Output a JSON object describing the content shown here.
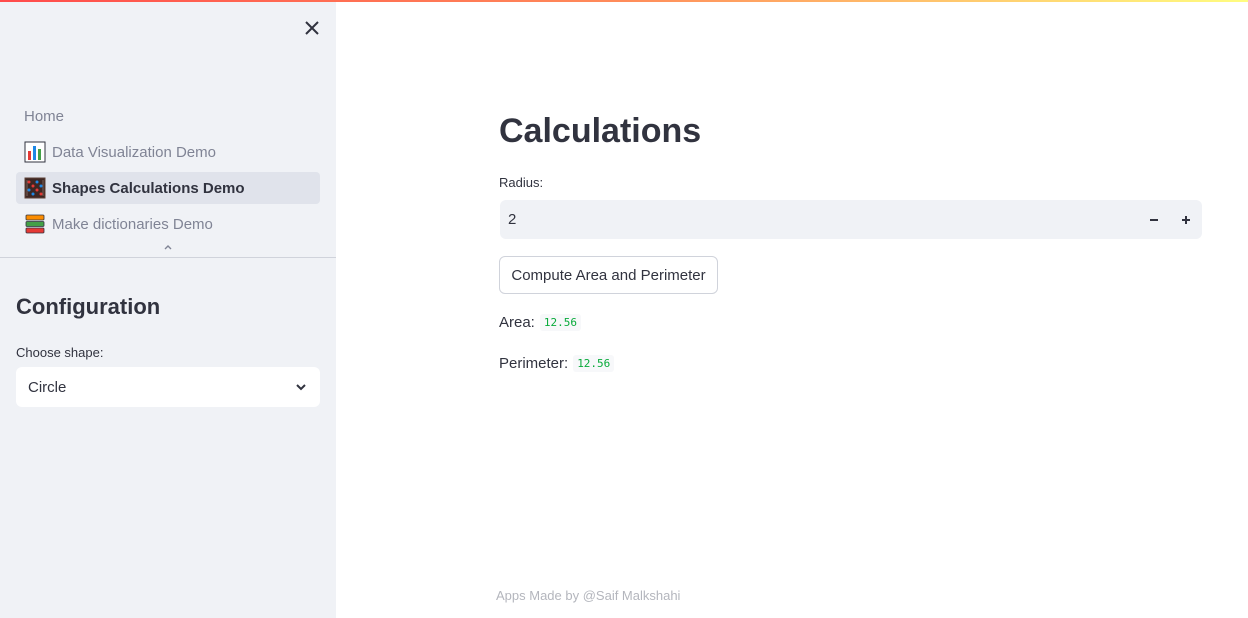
{
  "sidebar": {
    "nav_items": [
      {
        "label": "Home",
        "icon": "none",
        "active": false
      },
      {
        "label": "Data Visualization Demo",
        "icon": "bar-chart-emoji",
        "active": false
      },
      {
        "label": "Shapes Calculations Demo",
        "icon": "abacus-emoji",
        "active": true
      },
      {
        "label": "Make dictionaries Demo",
        "icon": "books-emoji",
        "active": false
      }
    ],
    "config_title": "Configuration",
    "shape_label": "Choose shape:",
    "shape_value": "Circle"
  },
  "main": {
    "title": "Calculations",
    "radius_label": "Radius:",
    "radius_value": "2",
    "compute_button": "Compute Area and Perimeter",
    "area_label": "Area:",
    "area_value": "12.56",
    "perimeter_label": "Perimeter:",
    "perimeter_value": "12.56"
  },
  "footer": "Apps Made by @Saif Malkshahi",
  "colors": {
    "sidebar_bg": "#f0f2f6",
    "accent_gradient_start": "#ff4b4b",
    "accent_gradient_end": "#fffd80",
    "code_text": "#09ab3b"
  }
}
